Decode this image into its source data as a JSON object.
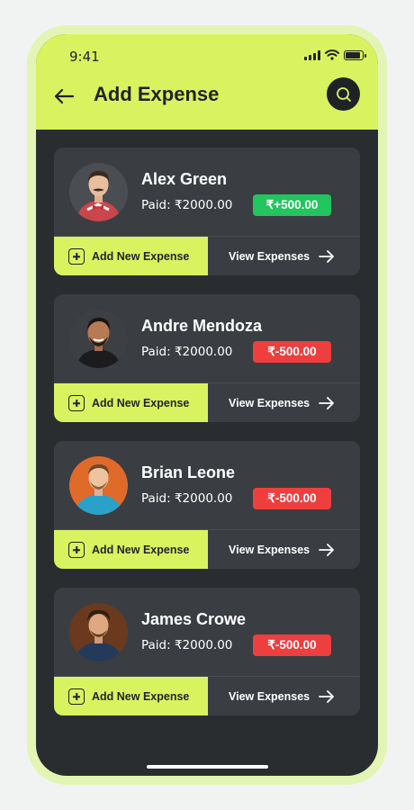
{
  "status": {
    "time": "9:41"
  },
  "header": {
    "title": "Add Expense"
  },
  "colors": {
    "accent": "#d9f25f",
    "dark": "#1f2326",
    "positive": "#22c55e",
    "negative": "#ef3e3e"
  },
  "people": [
    {
      "name": "Alex Green",
      "paid": "Paid: ₹2000.00",
      "balance": "₹+500.00",
      "status": "positive",
      "add_label": "Add New Expense",
      "view_label": "View Expenses"
    },
    {
      "name": "Andre Mendoza",
      "paid": "Paid: ₹2000.00",
      "balance": "₹-500.00",
      "status": "negative",
      "add_label": "Add New Expense",
      "view_label": "View Expenses"
    },
    {
      "name": "Brian Leone",
      "paid": "Paid: ₹2000.00",
      "balance": "₹-500.00",
      "status": "negative",
      "add_label": "Add New Expense",
      "view_label": "View Expenses"
    },
    {
      "name": "James Crowe",
      "paid": "Paid: ₹2000.00",
      "balance": "₹-500.00",
      "status": "negative",
      "add_label": "Add New Expense",
      "view_label": "View Expenses"
    }
  ]
}
